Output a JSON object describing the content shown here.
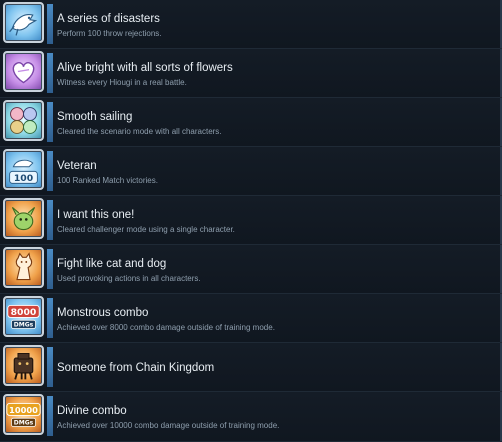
{
  "achievements": [
    {
      "title": "A series of disasters",
      "desc": "Perform 100 throw rejections.",
      "icon": "leaping-creature-icon",
      "color": "blue"
    },
    {
      "title": "Alive bright with all sorts of flowers",
      "desc": "Witness every Hiougi in a real battle.",
      "icon": "heart-icon",
      "color": "purple"
    },
    {
      "title": "Smooth sailing",
      "desc": "Cleared the scenario mode with all characters.",
      "icon": "character-faces-icon",
      "color": "teal"
    },
    {
      "title": "Veteran",
      "desc": "100 Ranked Match victories.",
      "icon": "badge-100-icon",
      "badge": "100",
      "color": "blue"
    },
    {
      "title": "I want this one!",
      "desc": "Cleared challenger mode using a single character.",
      "icon": "green-creature-icon",
      "color": "orange"
    },
    {
      "title": "Fight like cat and dog",
      "desc": "Used provoking actions in all characters.",
      "icon": "cat-figure-icon",
      "color": "orange"
    },
    {
      "title": "Monstrous combo",
      "desc": "Achieved over 8000 combo damage outside of training mode.",
      "icon": "badge-8000-dmgs-icon",
      "badge": "8000",
      "badge_sub": "DMGs",
      "color": "blue"
    },
    {
      "title": "Someone from Chain Kingdom",
      "desc": "",
      "icon": "robot-figure-icon",
      "color": "orange"
    },
    {
      "title": "Divine combo",
      "desc": "Achieved over 10000 combo damage outside of training mode.",
      "icon": "badge-10000-dmgs-icon",
      "badge": "10000",
      "badge_sub": "DMGs",
      "color": "orange"
    }
  ],
  "colors": {
    "accent": "#4a8bc4",
    "background": "#0d1219",
    "title": "#e8eef3",
    "description": "#8f9fae"
  }
}
